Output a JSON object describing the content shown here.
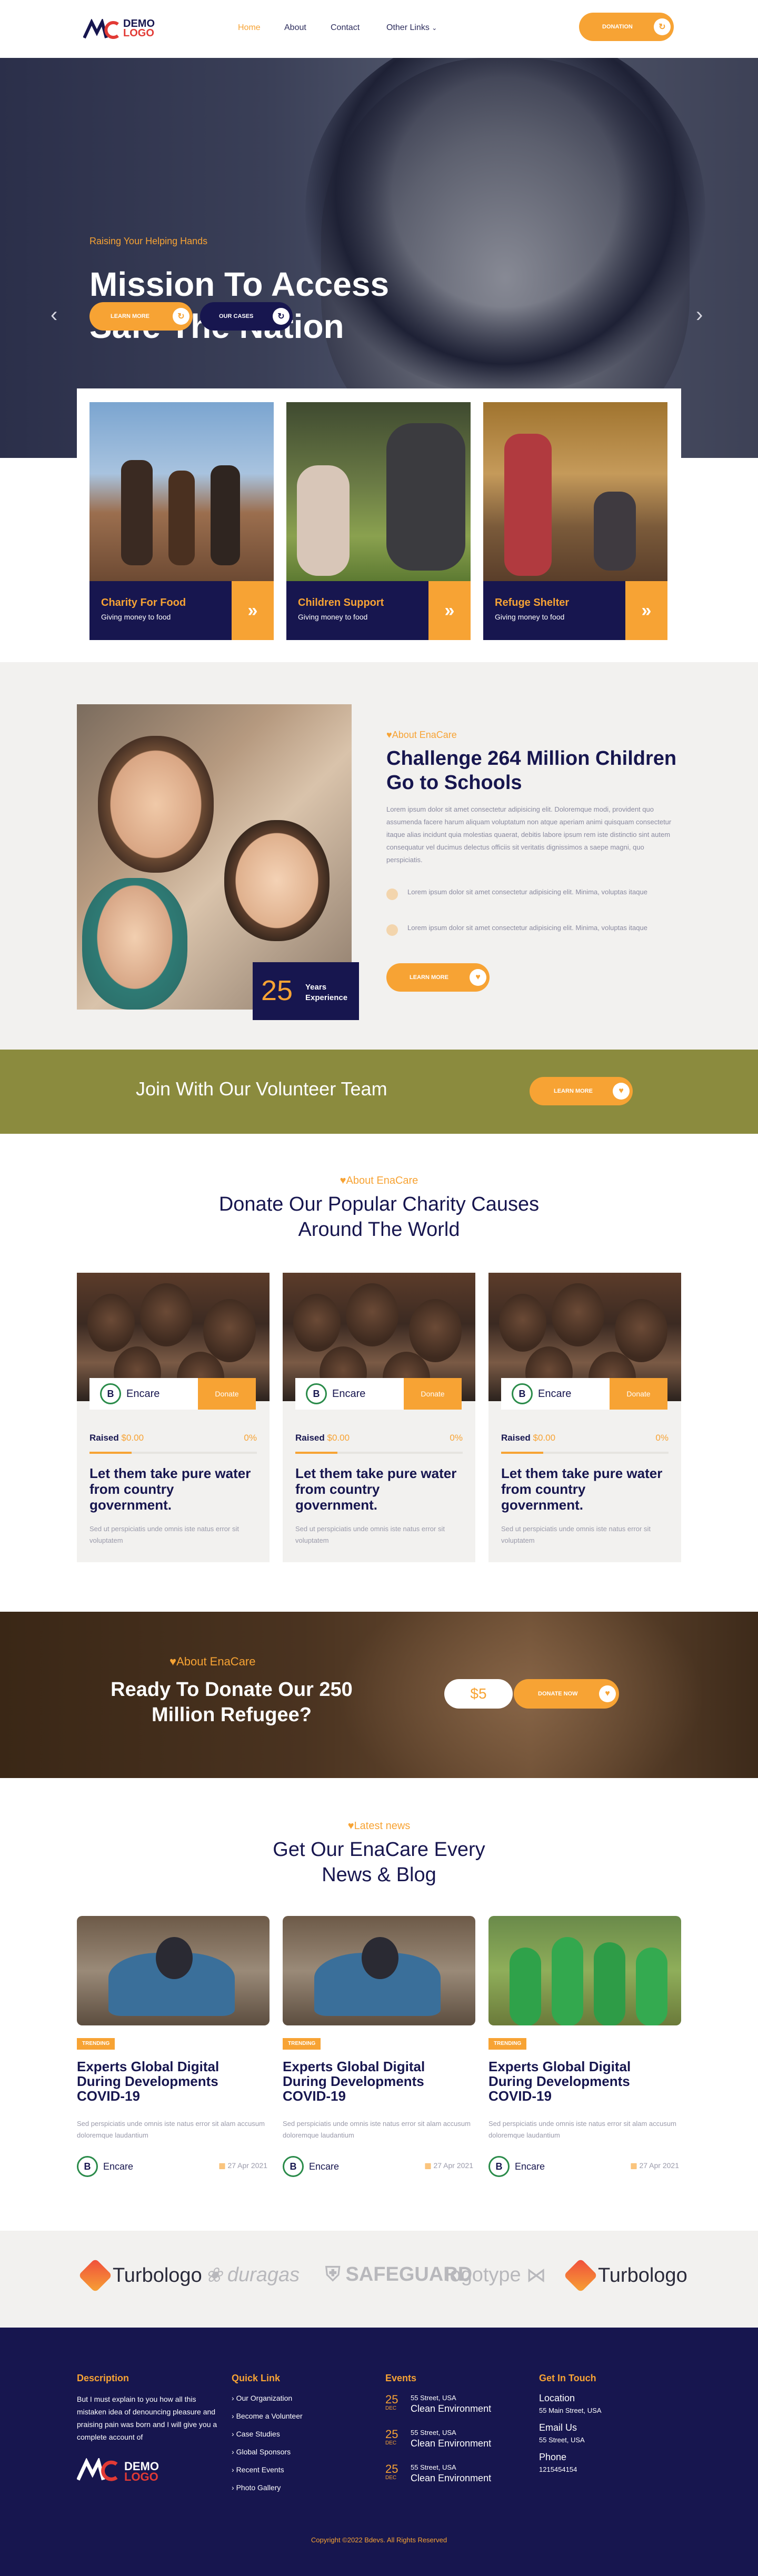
{
  "header": {
    "logo": {
      "line1": "DEMO",
      "line2": "LOGO"
    },
    "nav": [
      {
        "label": "Home"
      },
      {
        "label": "About"
      },
      {
        "label": "Contact"
      },
      {
        "label": "Other Links"
      }
    ],
    "donation_label": "DONATION"
  },
  "hero": {
    "subtitle": "Raising Your Helping Hands",
    "title": "Mission To Access Safe The Nation",
    "learn_more": "LEARN MORE",
    "our_cases": "OUR CASES"
  },
  "causes_cards": [
    {
      "title": "Charity For Food",
      "subtitle": "Giving money to food"
    },
    {
      "title": "Children Support",
      "subtitle": "Giving money to food"
    },
    {
      "title": "Refuge Shelter",
      "subtitle": "Giving money to food"
    }
  ],
  "about": {
    "eyebrow": "About EnaCare",
    "title": "Challenge 264 Million Children Go to Schools",
    "paragraph": "Lorem ipsum dolor sit amet consectetur adipisicing elit. Doloremque modi, provident quo assumenda facere harum aliquam voluptatum non atque aperiam animi quisquam consectetur itaque alias incidunt quia molestias quaerat, debitis labore ipsum rem iste distinctio sint autem consequatur vel ducimus delectus officiis sit veritatis dignissimos a saepe magni, quo perspiciatis.",
    "bullets": [
      "Lorem ipsum dolor sit amet consectetur adipisicing elit. Minima, voluptas itaque",
      "Lorem ipsum dolor sit amet consectetur adipisicing elit. Minima, voluptas itaque"
    ],
    "learn_more": "LEARN MORE",
    "years_number": "25",
    "years_label_1": "Years",
    "years_label_2": "Experience"
  },
  "volunteer": {
    "title": "Join With Our Volunteer Team",
    "learn_more": "LEARN MORE"
  },
  "charity": {
    "eyebrow": "About EnaCare",
    "title_1": "Donate Our Popular Charity Causes",
    "title_2": "Around The World",
    "cards": [
      {
        "org": "Encare",
        "donate": "Donate",
        "raised_label": "Raised",
        "raised_amount": "$0.00",
        "percent": "0%",
        "progress": 0.25,
        "title": "Let them take pure water from country government.",
        "text": "Sed ut perspiciatis unde omnis iste natus error sit voluptatem"
      },
      {
        "org": "Encare",
        "donate": "Donate",
        "raised_label": "Raised",
        "raised_amount": "$0.00",
        "percent": "0%",
        "progress": 0.25,
        "title": "Let them take pure water from country government.",
        "text": "Sed ut perspiciatis unde omnis iste natus error sit voluptatem"
      },
      {
        "org": "Encare",
        "donate": "Donate",
        "raised_label": "Raised",
        "raised_amount": "$0.00",
        "percent": "0%",
        "progress": 0.25,
        "title": "Let them take pure water from country government.",
        "text": "Sed ut perspiciatis unde omnis iste natus error sit voluptatem"
      }
    ]
  },
  "donate_banner": {
    "eyebrow": "About EnaCare",
    "title": "Ready To Donate Our 250 Million Refugee?",
    "amount": "$5",
    "donate_now": "DONATE NOW"
  },
  "news": {
    "eyebrow": "Latest news",
    "title_1": "Get Our EnaCare Every",
    "title_2": "News & Blog",
    "cards": [
      {
        "tag": "TRENDING",
        "title": "Experts Global Digital During Developments COVID-19",
        "text": "Sed perspiciatis unde omnis iste natus error sit alam accusum doloremque laudantium",
        "author": "Encare",
        "date": "27 Apr 2021"
      },
      {
        "tag": "TRENDING",
        "title": "Experts Global Digital During Developments COVID-19",
        "text": "Sed perspiciatis unde omnis iste natus error sit alam accusum doloremque laudantium",
        "author": "Encare",
        "date": "27 Apr 2021"
      },
      {
        "tag": "TRENDING",
        "title": "Experts Global Digital During Developments COVID-19",
        "text": "Sed perspiciatis unde omnis iste natus error sit alam accusum doloremque laudantium",
        "author": "Encare",
        "date": "27 Apr 2021"
      }
    ]
  },
  "brands": [
    "Turbologo",
    "duragas",
    "SAFEGUARD",
    "logotype",
    "Turbologo"
  ],
  "footer": {
    "description_head": "Description",
    "description": "But I must explain to you how all this mistaken idea of denouncing pleasure and praising pain was born and I will give you a complete account of",
    "logo": {
      "line1": "DEMO",
      "line2": "LOGO"
    },
    "quick_link_head": "Quick Link",
    "quick_links": [
      "Our Organization",
      "Become a Volunteer",
      "Case Studies",
      "Global Sponsors",
      "Recent Events",
      "Photo Gallery"
    ],
    "events_head": "Events",
    "events": [
      {
        "day": "25",
        "month": "DEC",
        "address": "55 Street, USA",
        "title": "Clean Environment"
      },
      {
        "day": "25",
        "month": "DEC",
        "address": "55 Street, USA",
        "title": "Clean Environment"
      },
      {
        "day": "25",
        "month": "DEC",
        "address": "55 Street, USA",
        "title": "Clean Environment"
      }
    ],
    "touch_head": "Get In Touch",
    "location_head": "Location",
    "location": "55 Main Street, USA",
    "email_head": "Email Us",
    "email": "55 Street, USA",
    "phone_head": "Phone",
    "phone": "1215454154",
    "copyright": "Copyright ©2022 Bdevs. All Rights Reserved"
  },
  "colors": {
    "accent": "#f7a334",
    "navy": "#17164f",
    "olive": "#8b8b3e",
    "light_bg": "#f2f1ef"
  }
}
